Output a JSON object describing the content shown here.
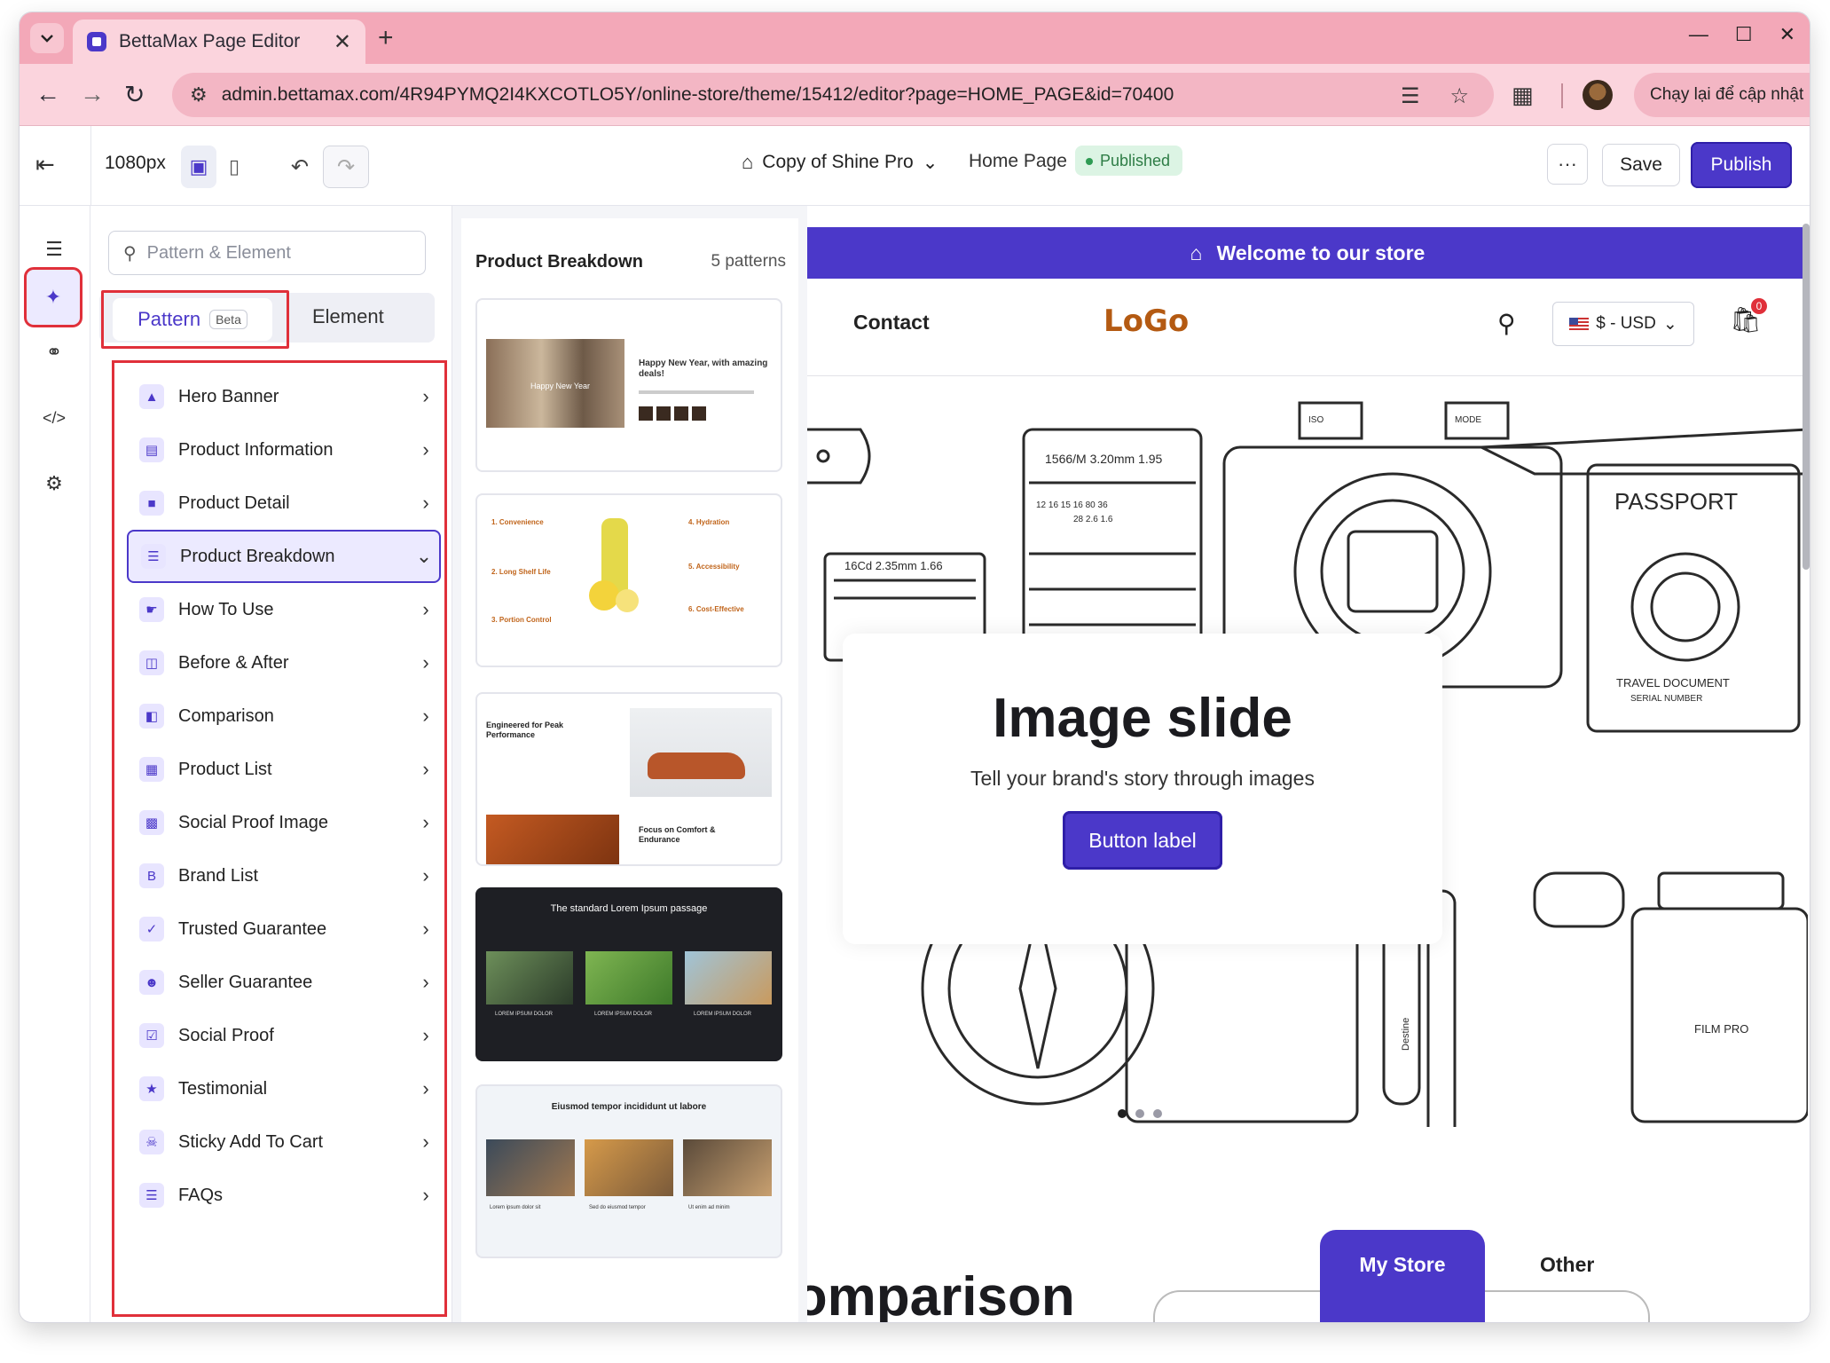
{
  "browser": {
    "tab_title": "BettaMax Page Editor",
    "tab_close": "✕",
    "new_tab": "+",
    "url": "admin.bettamax.com/4R94PYMQ2I4KXCOTLO5Y/online-store/theme/15412/editor?page=HOME_PAGE&id=70400",
    "relaunch_label": "Chạy lại để cập nhật",
    "colors": {
      "tabbar": "#f3a8b8",
      "addressbar": "#fbd4dd"
    }
  },
  "toolbar": {
    "width_label": "1080px",
    "theme_name": "Copy of Shine Pro",
    "page_name": "Home Page",
    "status": "Published",
    "more_label": "···",
    "save_label": "Save",
    "publish_label": "Publish",
    "accent": "#4b38c9"
  },
  "rail": {
    "icons": [
      "layers-icon",
      "puzzle-icon",
      "link-icon",
      "code-icon",
      "settings-icon"
    ],
    "active": "puzzle-icon"
  },
  "panel": {
    "search_placeholder": "Pattern & Element",
    "tabs": {
      "pattern": "Pattern",
      "beta": "Beta",
      "element": "Element"
    },
    "categories": [
      {
        "label": "Hero Banner",
        "icon": "hero-banner-icon"
      },
      {
        "label": "Product Information",
        "icon": "product-information-icon"
      },
      {
        "label": "Product Detail",
        "icon": "product-detail-icon"
      },
      {
        "label": "Product Breakdown",
        "icon": "product-breakdown-icon",
        "expanded": true
      },
      {
        "label": "How To Use",
        "icon": "how-to-use-icon"
      },
      {
        "label": "Before & After",
        "icon": "before-after-icon"
      },
      {
        "label": "Comparison",
        "icon": "comparison-icon"
      },
      {
        "label": "Product List",
        "icon": "product-list-icon"
      },
      {
        "label": "Social Proof Image",
        "icon": "social-proof-image-icon"
      },
      {
        "label": "Brand List",
        "icon": "brand-list-icon"
      },
      {
        "label": "Trusted Guarantee",
        "icon": "trusted-guarantee-icon"
      },
      {
        "label": "Seller Guarantee",
        "icon": "seller-guarantee-icon"
      },
      {
        "label": "Social Proof",
        "icon": "social-proof-icon"
      },
      {
        "label": "Testimonial",
        "icon": "testimonial-icon"
      },
      {
        "label": "Sticky Add To Cart",
        "icon": "cart-icon"
      },
      {
        "label": "FAQs",
        "icon": "faq-list-icon"
      }
    ]
  },
  "patterns": {
    "title": "Product Breakdown",
    "count": "5 patterns",
    "cards": [
      {
        "heading": "Happy New Year, with amazing deals!",
        "overlay": "Happy New Year"
      },
      {
        "labels": [
          "1. Convenience",
          "2. Long Shelf Life",
          "3. Portion Control",
          "4. Hydration",
          "5. Accessibility",
          "6. Cost-Effective"
        ]
      },
      {
        "labels": [
          "Engineered for Peak Performance",
          "Focus on Comfort & Endurance"
        ]
      },
      {
        "heading": "The standard Lorem Ipsum passage",
        "labels": [
          "LOREM IPSUM DOLOR",
          "LOREM IPSUM DOLOR",
          "LOREM IPSUM DOLOR"
        ]
      },
      {
        "heading": "Eiusmod tempor incididunt ut labore",
        "labels": [
          "Lorem ipsum dolor sit",
          "Sed do eiusmod tempor",
          "Ut enim ad minim"
        ]
      }
    ]
  },
  "store": {
    "announcement": "Welcome to our store",
    "nav_contact": "Contact",
    "logo": "LoGo",
    "currency": "$ - USD",
    "cart_count": "0",
    "hero": {
      "title": "Image slide",
      "subtitle": "Tell your brand's story through images",
      "button": "Button label",
      "illustration_labels": [
        "1566/M 3.20mm 1.95",
        "16Cd 2.35mm 1.66",
        "PASSPORT",
        "TRAVEL DOCUMENT",
        "SERIAL NUMBER",
        "FILM PRO",
        "Destine",
        "ISO",
        "MODE",
        "12 16 15 16 80 36",
        "28 2.6 1.6"
      ],
      "slides": 3,
      "active_slide": 1
    },
    "comparison": {
      "title": "Comparison",
      "tab_mystore": "My Store",
      "tab_other": "Other"
    }
  }
}
